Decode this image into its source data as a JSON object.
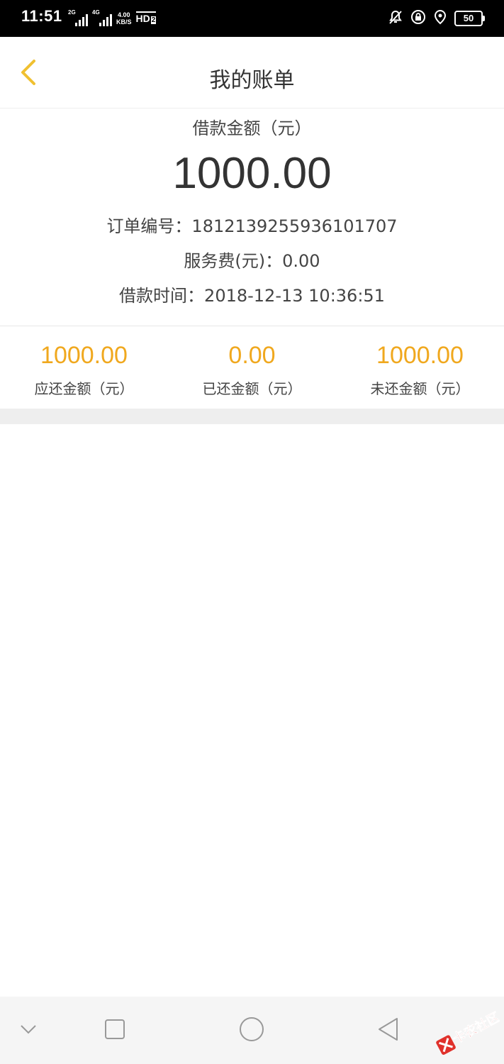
{
  "status_bar": {
    "time": "11:51",
    "sim1": "2G",
    "sim2": "4G",
    "speed_value": "4.00",
    "speed_unit": "KB/S",
    "hd": "HD",
    "hd_index": "2",
    "battery": "50"
  },
  "header": {
    "title": "我的账单"
  },
  "summary": {
    "amount_label": "借款金额（元）",
    "amount": "1000.00",
    "order_no": "订单编号：1812139255936101707",
    "service_fee": "服务费(元)：0.00",
    "borrow_time": "借款时间：2018-12-13 10:36:51"
  },
  "stats": [
    {
      "value": "1000.00",
      "label": "应还金额（元）"
    },
    {
      "value": "0.00",
      "label": "已还金额（元）"
    },
    {
      "value": "1000.00",
      "label": "未还金额（元）"
    }
  ],
  "watermark": {
    "text": "卡农社区"
  },
  "colors": {
    "accent": "#f0a81e",
    "back_arrow": "#f0c030",
    "text": "#333333",
    "divider": "#eeeeee"
  },
  "icons": {
    "back": "chevron-left-icon",
    "nav_down": "chevron-down-icon",
    "nav_recent": "square-icon",
    "nav_home": "circle-icon",
    "nav_back": "triangle-left-icon",
    "status": [
      "mute-bell-icon",
      "rotation-lock-icon",
      "location-icon"
    ]
  }
}
